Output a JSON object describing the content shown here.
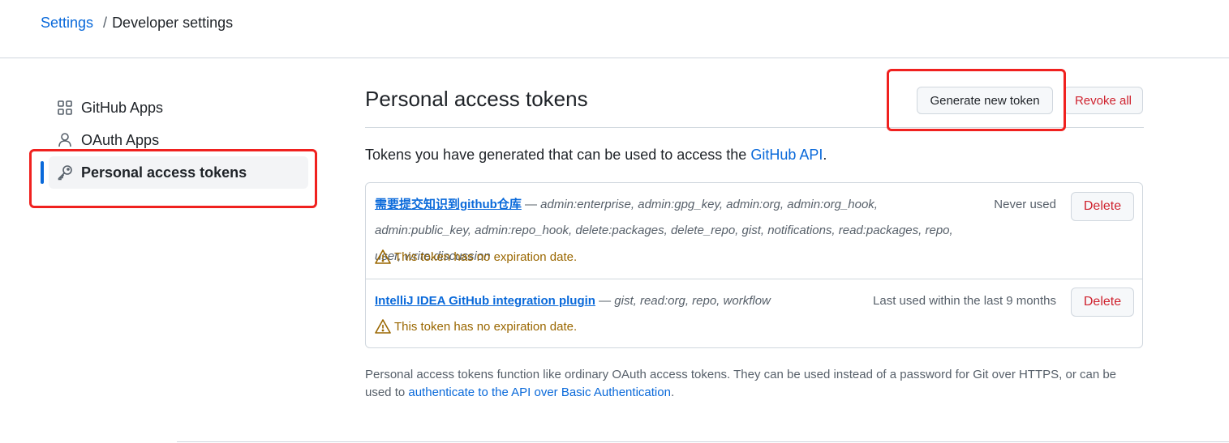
{
  "breadcrumb": {
    "root": "Settings",
    "separator": "/",
    "current": "Developer settings"
  },
  "sidebar": {
    "items": [
      {
        "label": "GitHub Apps",
        "icon": "apps-grid-icon",
        "active": false
      },
      {
        "label": "OAuth Apps",
        "icon": "person-icon",
        "active": false
      },
      {
        "label": "Personal access tokens",
        "icon": "key-icon",
        "active": true
      }
    ]
  },
  "main": {
    "title": "Personal access tokens",
    "generate_button": "Generate new token",
    "revoke_button": "Revoke all",
    "intro_text": "Tokens you have generated that can be used to access the ",
    "intro_link": "GitHub API",
    "intro_end": ".",
    "tokens": [
      {
        "name": "需要提交知识到github仓库",
        "dash": " — ",
        "scopes": "admin:enterprise, admin:gpg_key, admin:org, admin:org_hook, admin:public_key, admin:repo_hook, delete:packages, delete_repo, gist, notifications, read:packages, repo, user, write:discussion",
        "last_used": "Never used",
        "delete_label": "Delete",
        "warning": "This token has no expiration date."
      },
      {
        "name": "IntelliJ IDEA GitHub integration plugin",
        "dash": " — ",
        "scopes": "gist, read:org, repo, workflow",
        "last_used": "Last used within the last 9 months",
        "delete_label": "Delete",
        "warning": "This token has no expiration date."
      }
    ],
    "footnote_text": "Personal access tokens function like ordinary OAuth access tokens. They can be used instead of a password for Git over HTTPS, or can be used to ",
    "footnote_link": "authenticate to the API over Basic Authentication",
    "footnote_end": "."
  },
  "colors": {
    "link": "#0969da",
    "danger": "#cf222e",
    "warning": "#9a6700",
    "highlight_box": "#f0211f"
  }
}
